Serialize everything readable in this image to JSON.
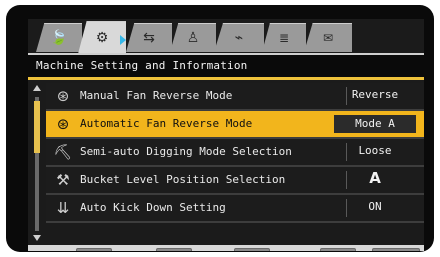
{
  "tabs": [
    {
      "icon": "leaf-icon",
      "glyph": "🍃"
    },
    {
      "icon": "machine-info-icon",
      "glyph": "⚙"
    },
    {
      "icon": "transfer-arrows-icon",
      "glyph": "⇆"
    },
    {
      "icon": "operator-icon",
      "glyph": "♙"
    },
    {
      "icon": "attachment-icon",
      "glyph": "⌁"
    },
    {
      "icon": "menu-list-icon",
      "glyph": "≣"
    },
    {
      "icon": "message-icon",
      "glyph": "✉"
    }
  ],
  "header": {
    "title": "Machine Setting and Information"
  },
  "list": {
    "rows": [
      {
        "icon": "fan-icon",
        "label": "Manual Fan Reverse Mode",
        "value": "Reverse"
      },
      {
        "icon": "auto-fan-icon",
        "label": "Automatic Fan Reverse Mode",
        "value": "Mode A"
      },
      {
        "icon": "digging-icon",
        "label": "Semi-auto Digging Mode Selection",
        "value": "Loose"
      },
      {
        "icon": "bucket-level-icon",
        "label": "Bucket Level Position Selection",
        "value": "A"
      },
      {
        "icon": "kickdown-icon",
        "label": "Auto Kick Down Setting",
        "value": "ON"
      }
    ]
  },
  "bottom": {
    "buttons": [
      {
        "name": "up-button",
        "glyph": "▲"
      },
      {
        "name": "down-button",
        "glyph": "▼"
      },
      {
        "name": "back-button",
        "glyph": "↶"
      },
      {
        "name": "confirm-button",
        "glyph": "✓"
      }
    ]
  },
  "colors": {
    "accent": "#f2b51c",
    "accent_highlight": "#36b7e8"
  }
}
